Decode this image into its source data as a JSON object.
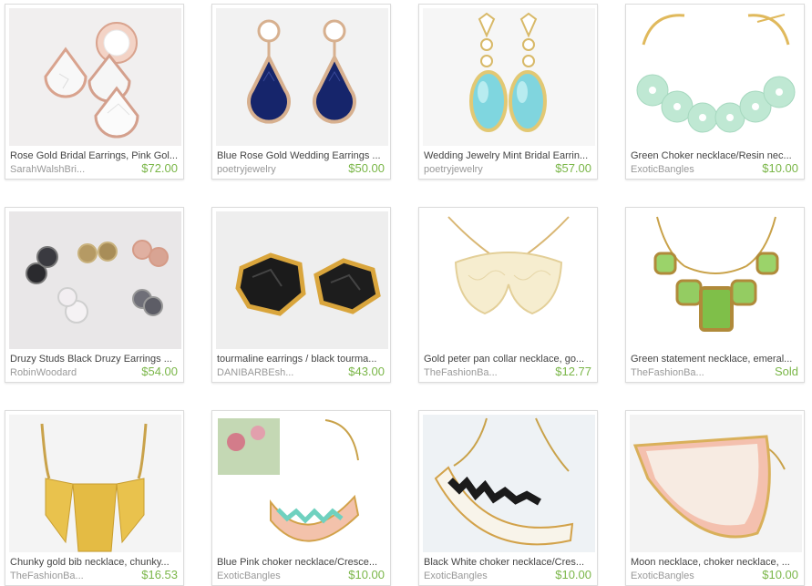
{
  "listings": [
    {
      "title": "Rose Gold Bridal Earrings, Pink Gol...",
      "shop": "SarahWalshBri...",
      "price": "$72.00"
    },
    {
      "title": "Blue Rose Gold Wedding Earrings ...",
      "shop": "poetryjewelry",
      "price": "$50.00"
    },
    {
      "title": "Wedding Jewelry Mint Bridal Earrin...",
      "shop": "poetryjewelry",
      "price": "$57.00"
    },
    {
      "title": "Green Choker necklace/Resin nec...",
      "shop": "ExoticBangles",
      "price": "$10.00"
    },
    {
      "title": "Druzy Studs Black Druzy Earrings ...",
      "shop": "RobinWoodard",
      "price": "$54.00"
    },
    {
      "title": "tourmaline earrings / black tourma...",
      "shop": "DANIBARBEsh...",
      "price": "$43.00"
    },
    {
      "title": "Gold peter pan collar necklace, go...",
      "shop": "TheFashionBa...",
      "price": "$12.77"
    },
    {
      "title": "Green statement necklace, emeral...",
      "shop": "TheFashionBa...",
      "price": "Sold"
    },
    {
      "title": "Chunky gold bib necklace, chunky...",
      "shop": "TheFashionBa...",
      "price": "$16.53"
    },
    {
      "title": "Blue Pink choker necklace/Cresce...",
      "shop": "ExoticBangles",
      "price": "$10.00"
    },
    {
      "title": "Black White choker necklace/Cres...",
      "shop": "ExoticBangles",
      "price": "$10.00"
    },
    {
      "title": "Moon necklace, choker necklace, ...",
      "shop": "ExoticBangles",
      "price": "$10.00"
    }
  ]
}
